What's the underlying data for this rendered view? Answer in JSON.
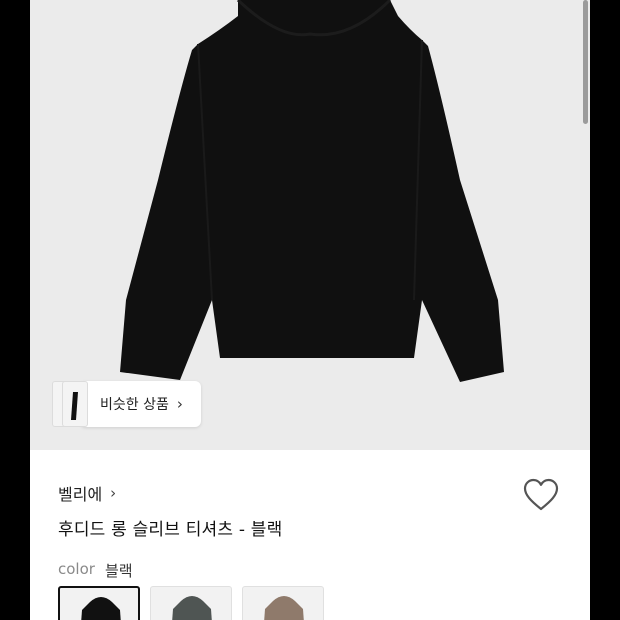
{
  "similar_chip": {
    "label": "비슷한 상품",
    "chevron": "›"
  },
  "product": {
    "brand": "벨리에",
    "brand_chevron": "›",
    "title": "후디드 롱 슬리브 티셔츠 - 블랙",
    "wishlist_icon": "heart-outline-icon"
  },
  "color": {
    "label": "color",
    "selected_value": "블랙",
    "options": [
      {
        "color": "#111111",
        "selected": true
      },
      {
        "color": "#4f5553",
        "selected": false
      },
      {
        "color": "#8f7a6b",
        "selected": false
      }
    ]
  },
  "colors": {
    "garment": "#101010",
    "hero_background": "#ebebeb",
    "page_background": "#ffffff"
  }
}
